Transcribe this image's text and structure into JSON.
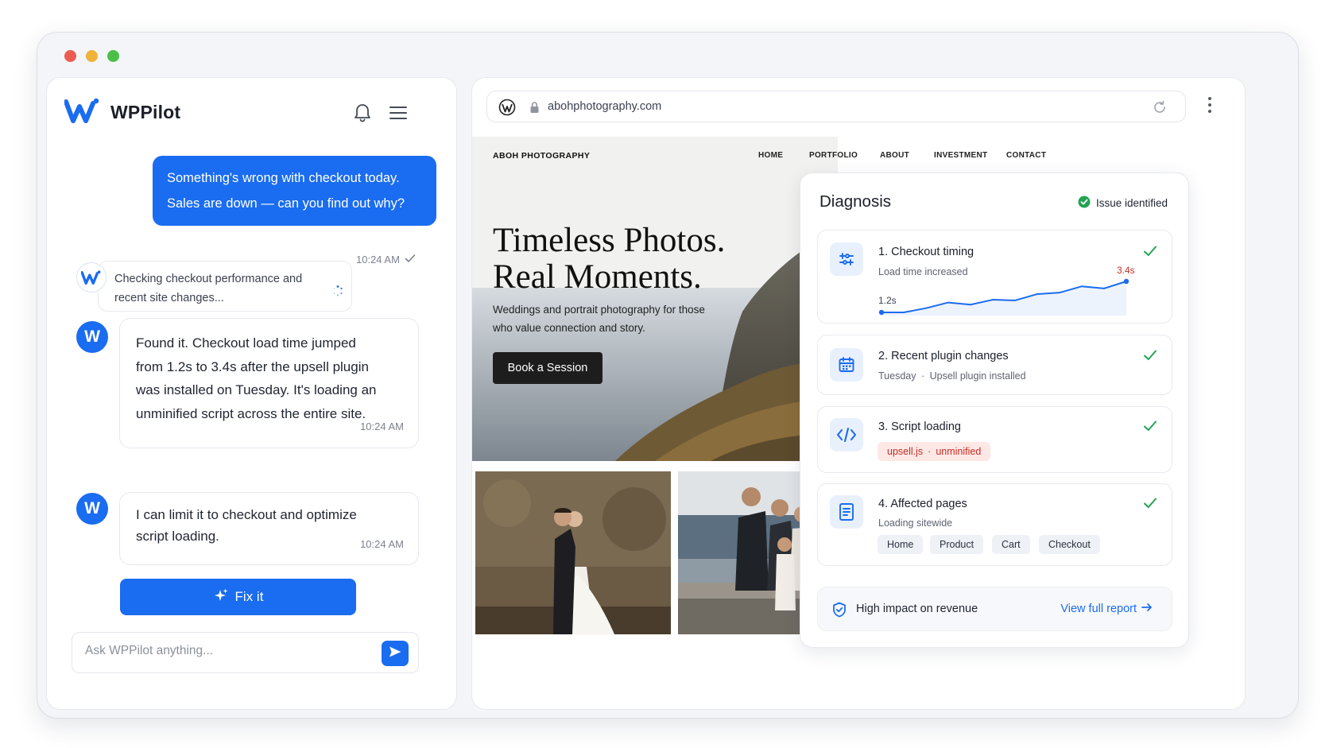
{
  "window": {
    "controls": {
      "close": "#ec5b4f",
      "minimize": "#f0b23b",
      "maximize": "#4cbf48"
    }
  },
  "chat": {
    "brand": "WPPilot",
    "user_message": {
      "line1": "Something's wrong with checkout today.",
      "line2": "Sales are down — can you find out why?",
      "time": "10:24 AM"
    },
    "status": {
      "line1": "Checking checkout performance and",
      "line2": "recent site changes..."
    },
    "bot_messages": [
      {
        "avatar": "W",
        "lines": [
          "Found it. Checkout load time jumped",
          "from 1.2s to 3.4s after the upsell plugin",
          "was installed on Tuesday. It's loading an",
          "unminified script across the entire site."
        ],
        "time": "10:24 AM"
      },
      {
        "avatar": "W",
        "lines": [
          "I can limit it to checkout and optimize",
          "script loading."
        ],
        "time": "10:24 AM"
      }
    ],
    "fix_button": "Fix it",
    "input_placeholder": "Ask WPPilot anything..."
  },
  "browser": {
    "url": "abohphotography.com"
  },
  "site": {
    "logo": "ABOH PHOTOGRAPHY",
    "nav": [
      "HOME",
      "PORTFOLIO",
      "ABOUT",
      "INVESTMENT",
      "CONTACT"
    ],
    "hero_title_line1": "Timeless Photos.",
    "hero_title_line2": "Real Moments.",
    "hero_sub_line1": "Weddings and portrait photography for those",
    "hero_sub_line2": "who value connection and story.",
    "cta": "Book a Session"
  },
  "diagnosis": {
    "title": "Diagnosis",
    "status": "Issue identified",
    "items": [
      {
        "title": "1. Checkout timing",
        "subtitle": "Load time increased",
        "chart_data": {
          "type": "line",
          "start_label": "1.2s",
          "end_label": "3.4s",
          "values": [
            1.2,
            1.2,
            1.5,
            1.9,
            1.75,
            2.1,
            2.05,
            2.5,
            2.6,
            3.05,
            2.9,
            3.4
          ]
        }
      },
      {
        "title": "2. Recent plugin changes",
        "subtitle_day": "Tuesday",
        "subtitle_sep": "·",
        "subtitle_detail": "Upsell plugin installed"
      },
      {
        "title": "3. Script loading",
        "tag_file": "upsell.js",
        "tag_sep": "·",
        "tag_status": "unminified"
      },
      {
        "title": "4. Affected pages",
        "subtitle": "Loading sitewide",
        "pages": [
          "Home",
          "Product",
          "Cart",
          "Checkout"
        ]
      }
    ],
    "impact": "High impact on revenue",
    "report_link": "View full report"
  },
  "colors": {
    "accent": "#1a6cf0",
    "success": "#22a352",
    "danger": "#c62f24"
  },
  "icons": [
    "wppilot-logo-icon",
    "bell-icon",
    "menu-icon",
    "spinner-icon",
    "sparkle-icon",
    "send-icon",
    "wordpress-icon",
    "lock-icon",
    "reload-icon",
    "kebab-icon",
    "check-circle-icon",
    "performance-icon",
    "calendar-icon",
    "code-icon",
    "document-icon",
    "check-icon",
    "shield-icon",
    "arrow-right-icon"
  ]
}
